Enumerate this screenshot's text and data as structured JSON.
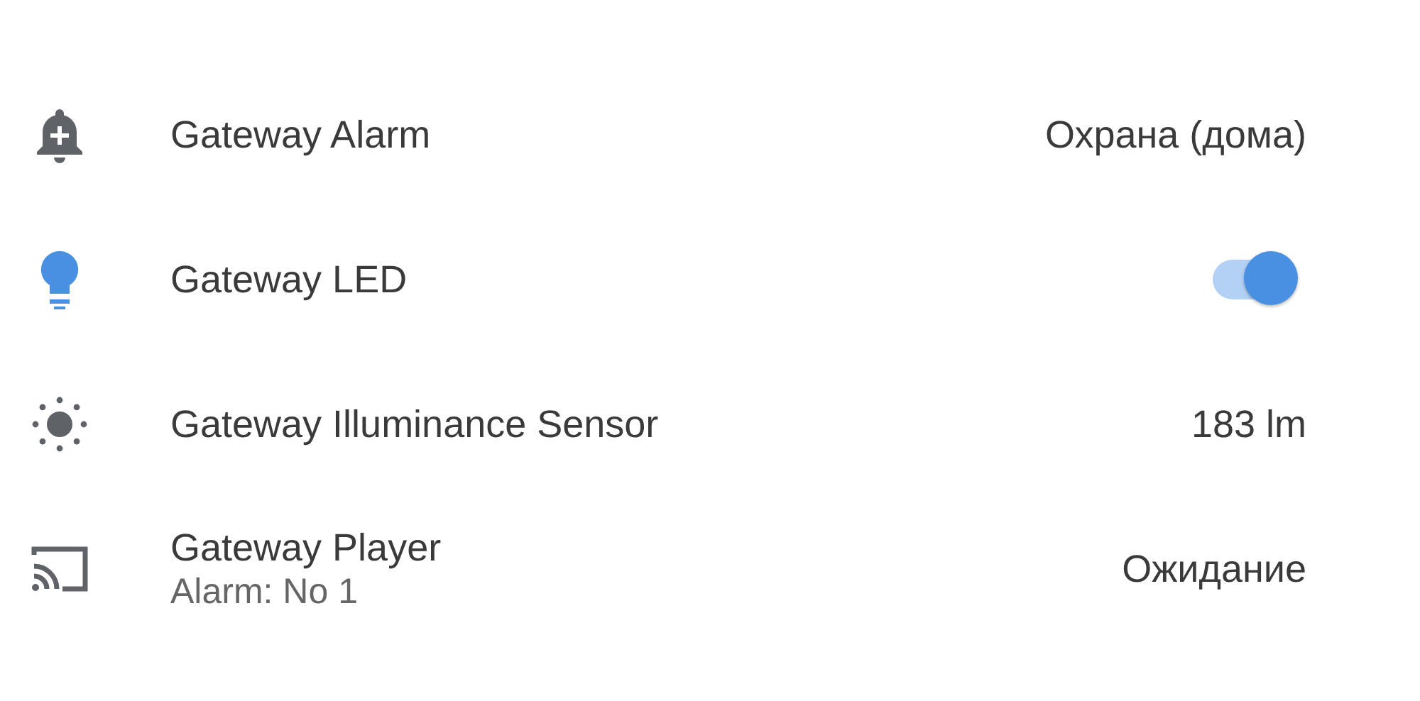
{
  "entities": [
    {
      "kind": "value",
      "name": "Gateway Alarm",
      "value": "Охрана (дома)"
    },
    {
      "kind": "toggle",
      "name": "Gateway LED",
      "on": true
    },
    {
      "kind": "value",
      "name": "Gateway Illuminance Sensor",
      "value": "183 lm"
    },
    {
      "kind": "value",
      "name": "Gateway Player",
      "secondary": "Alarm: No 1",
      "value": "Ожидание"
    }
  ]
}
